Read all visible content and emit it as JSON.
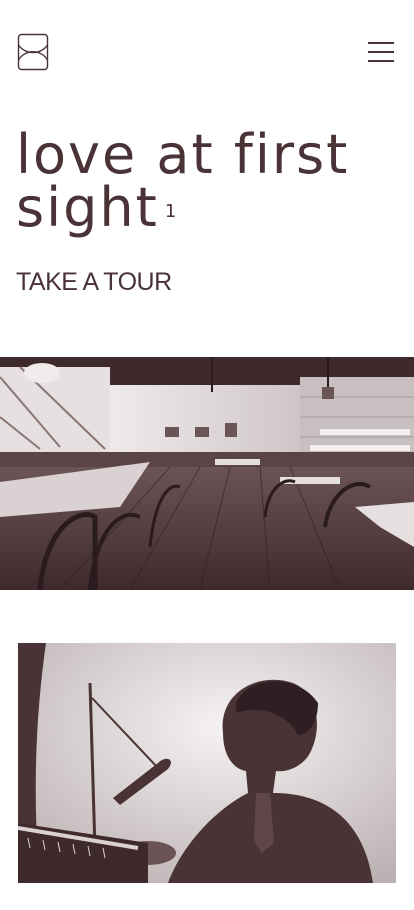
{
  "header": {
    "logo_icon": "logo-mark-icon",
    "menu_icon": "hamburger-menu-icon"
  },
  "hero": {
    "title": "love at first sight",
    "footnote": "1",
    "cta_label": "TAKE A TOUR"
  },
  "images": {
    "restaurant": "restaurant-interior-photo",
    "pianist": "pianist-photo"
  },
  "colors": {
    "brand": "#4a3336",
    "background": "#ffffff"
  }
}
